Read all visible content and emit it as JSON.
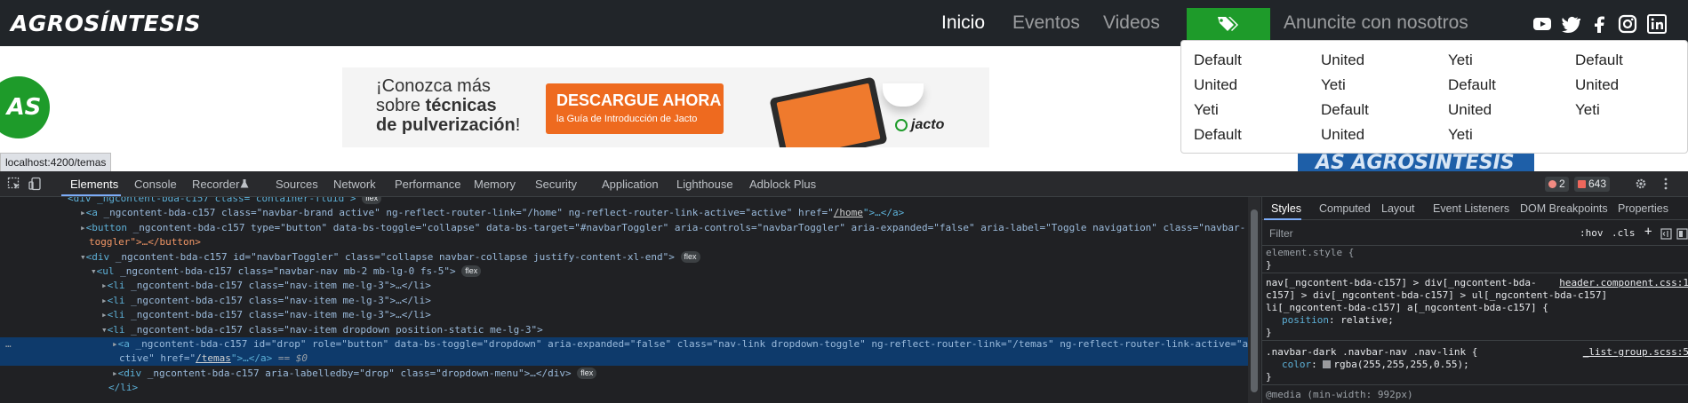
{
  "navbar": {
    "brand": "AGROSÍNTESIS",
    "links": [
      {
        "label": "Inicio"
      },
      {
        "label": "Eventos"
      },
      {
        "label": "Videos"
      },
      {
        "label": "Anuncite con nosotros"
      }
    ],
    "accent": "#1e9b2a",
    "tag_icon": "tag-icon",
    "social_icons": [
      "youtube-icon",
      "twitter-icon",
      "facebook-icon",
      "instagram-icon",
      "linkedin-icon"
    ]
  },
  "page": {
    "logo_text": "AS",
    "banner": {
      "line1": "¡Conozca más",
      "line2_a": "sobre ",
      "line2_b": "técnicas",
      "line3_a": "de pulverización",
      "line3_b": "!",
      "button_title": "DESCARGUE AHORA",
      "button_sub": "la Guía de Introducción de Jacto",
      "brand": "jacto"
    },
    "ad2_text": "AS AGROSÍNTESIS",
    "status_url": "localhost:4200/temas"
  },
  "dropdown": {
    "columns": [
      [
        "Default",
        "United",
        "Yeti",
        "Default"
      ],
      [
        "United",
        "Yeti",
        "Default",
        "United"
      ],
      [
        "Yeti",
        "Default",
        "United",
        "Yeti"
      ],
      [
        "Default",
        "United",
        "Yeti"
      ]
    ]
  },
  "devtools": {
    "tabs": [
      "Elements",
      "Console",
      "Recorder",
      "Sources",
      "Network",
      "Performance",
      "Memory",
      "Security",
      "Application",
      "Lighthouse",
      "Adblock Plus"
    ],
    "active_tab": "Elements",
    "errors": "2",
    "warnings": "643",
    "dom": {
      "r0": "<div _ngcontent-bda-c157 class=\"container-fluid\">",
      "r1_t": "<a",
      "r1_attrs": " _ngcontent-bda-c157 class=\"navbar-brand active\" ng-reflect-router-link=\"/home\" ng-reflect-router-link-active=\"active\" href=\"",
      "r1_link": "/home",
      "r1_end": "\">…</a>",
      "r2_t": "<button",
      "r2_attrs": " _ngcontent-bda-c157 type=\"button\" data-bs-toggle=\"collapse\" data-bs-target=\"#navbarToggler\" aria-controls=\"navbarToggler\" aria-expanded=\"false\" aria-label=\"Toggle navigation\" class=\"navbar-",
      "r3": "toggler\">…</button>",
      "r4_t": "<div",
      "r4_attrs": " _ngcontent-bda-c157 id=\"navbarToggler\" class=\"collapse navbar-collapse justify-content-xl-end\">",
      "r5_t": "<ul",
      "r5_attrs": " _ngcontent-bda-c157 class=\"navbar-nav mb-2 mb-lg-0 fs-5\">",
      "li_t": "<li",
      "li_attrs": " _ngcontent-bda-c157 class=\"nav-item me-lg-3\">…</li>",
      "r9_attrs": " _ngcontent-bda-c157 class=\"nav-item dropdown position-static me-lg-3\">",
      "r10_attrs": " _ngcontent-bda-c157 id=\"drop\" role=\"button\" data-bs-toggle=\"dropdown\" aria-expanded=\"false\" class=\"nav-link dropdown-toggle\" ng-reflect-router-link=\"/temas\" ng-reflect-router-link-active=\"a",
      "r11_a": "ctive\" href=\"",
      "r11_link": "/temas",
      "r11_end": "\">…</a>",
      "r11_dollar": " == $0",
      "r12_t": "<div",
      "r12_attrs": " _ngcontent-bda-c157 aria-labelledby=\"drop\" class=\"dropdown-menu\">…</div>",
      "r13": "</li>",
      "flex": "flex",
      "ellipsis": "…"
    }
  },
  "styles_pane": {
    "tabs": [
      "Styles",
      "Computed",
      "Layout",
      "Event Listeners",
      "DOM Breakpoints",
      "Properties"
    ],
    "filter_placeholder": "Filter",
    "hov": ":hov",
    "cls": ".cls",
    "element_style": "element.style {",
    "close_brace": "}",
    "rule1_sel_a": "nav[_ngcontent-bda-c157] > div[_ngcontent-bda-",
    "rule1_sel_b": "c157] > div[_ngcontent-bda-c157] > ul[_ngcontent-bda-c157]",
    "rule1_sel_c": "li[_ngcontent-bda-c157] a[_ngcontent-bda-c157] {",
    "rule1_src": "header.component.css:1",
    "rule1_prop": "position",
    "rule1_val": "relative;",
    "rule2_sel": ".navbar-dark .navbar-nav .nav-link {",
    "rule2_src": "_list-group.scss:5",
    "rule2_prop": "color",
    "rule2_val": "rgba(255,255,255,0.55);",
    "media": "@media (min-width: 992px)"
  }
}
